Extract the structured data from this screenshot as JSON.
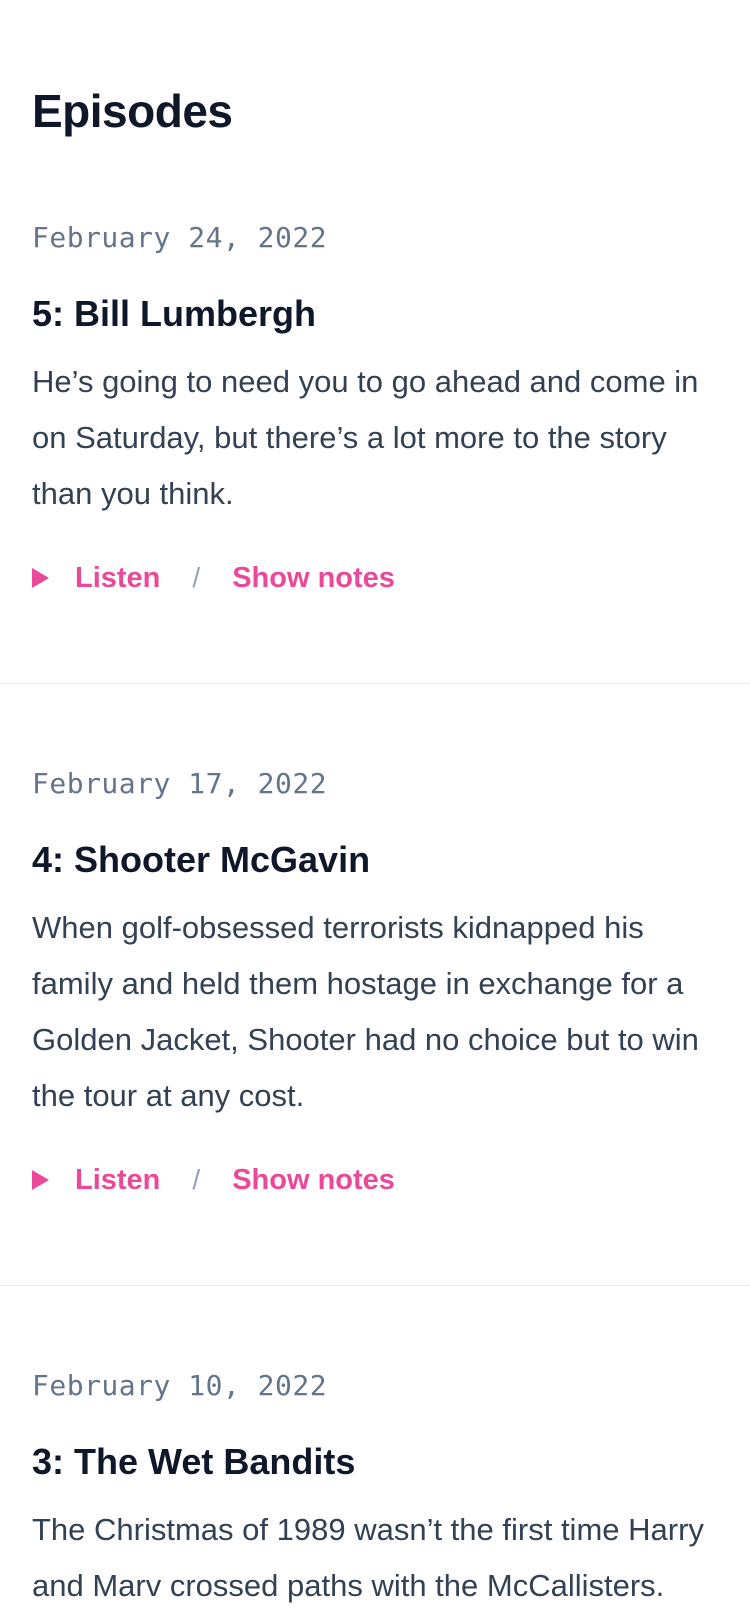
{
  "page": {
    "title": "Episodes"
  },
  "episodes": [
    {
      "date": "February 24, 2022",
      "title": "5: Bill Lumbergh",
      "description": "He’s going to need you to go ahead and come in on Saturday, but there’s a lot more to the story than you think.",
      "listen_label": "Listen",
      "separator": "/",
      "notes_label": "Show notes"
    },
    {
      "date": "February 17, 2022",
      "title": "4: Shooter McGavin",
      "description": "When golf-obsessed terrorists kidnapped his family and held them hostage in exchange for a Golden Jacket, Shooter had no choice but to win the tour at any cost.",
      "listen_label": "Listen",
      "separator": "/",
      "notes_label": "Show notes"
    },
    {
      "date": "February 10, 2022",
      "title": "3: The Wet Bandits",
      "description": "The Christmas of 1989 wasn’t the first time Harry and Marv crossed paths with the McCallisters."
    }
  ],
  "colors": {
    "accent": "#ec4899",
    "heading": "#0f172a",
    "body_text": "#334155",
    "date_text": "#64748b",
    "divider": "#e8ebef"
  },
  "icons": {
    "listen": "play-icon"
  }
}
